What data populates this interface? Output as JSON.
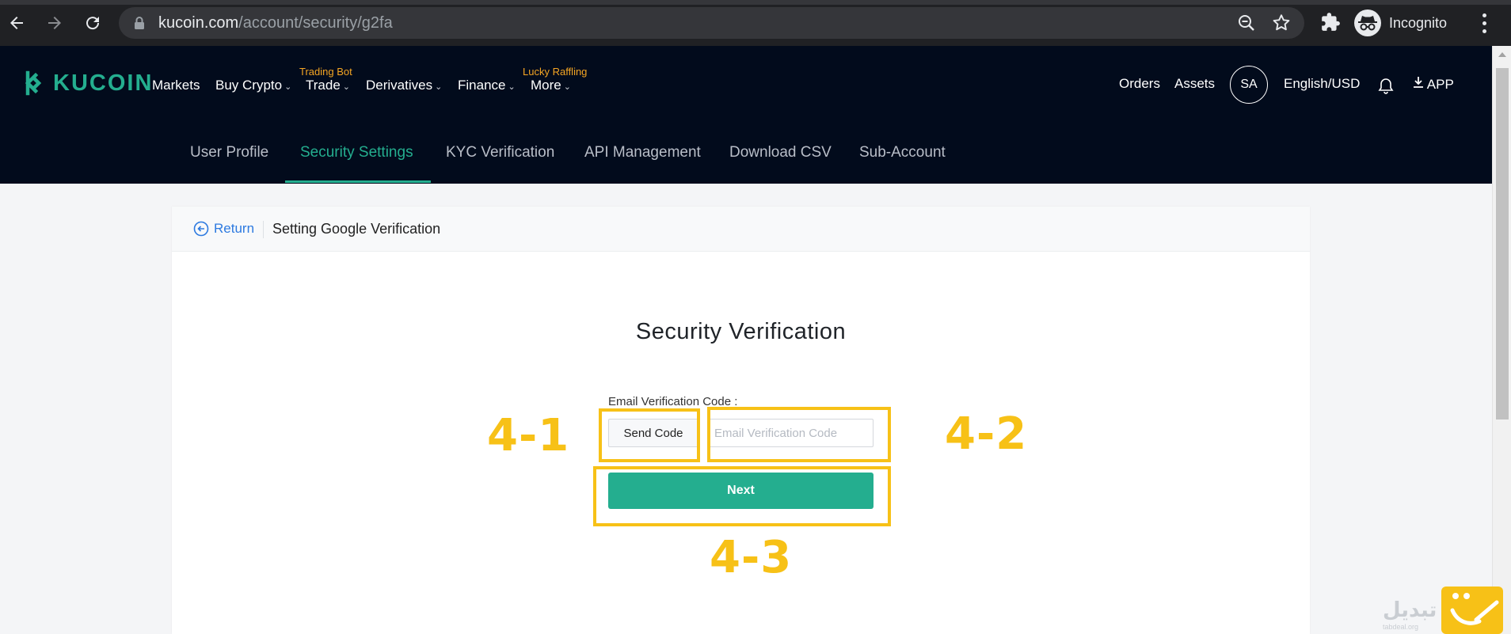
{
  "browser": {
    "url_host": "kucoin.com",
    "url_path": "/account/security/g2fa",
    "profile_label": "Incognito",
    "icons": [
      "back-icon",
      "forward-icon",
      "reload-icon",
      "lock-icon",
      "zoom-icon",
      "star-icon",
      "extensions-icon",
      "incognito-icon",
      "menu-icon"
    ]
  },
  "header": {
    "logo_text": "KUCOIN",
    "nav": [
      {
        "label": "Markets",
        "dropdown": false,
        "tag": ""
      },
      {
        "label": "Buy Crypto",
        "dropdown": true,
        "tag": ""
      },
      {
        "label": "Trade",
        "dropdown": true,
        "tag": "Trading Bot"
      },
      {
        "label": "Derivatives",
        "dropdown": true,
        "tag": ""
      },
      {
        "label": "Finance",
        "dropdown": true,
        "tag": ""
      },
      {
        "label": "More",
        "dropdown": true,
        "tag": "Lucky Raffling"
      }
    ],
    "right": {
      "orders": "Orders",
      "assets": "Assets",
      "avatar_initials": "SA",
      "language": "English/USD",
      "app": "APP"
    }
  },
  "subnav": {
    "tabs": [
      "User Profile",
      "Security Settings",
      "KYC Verification",
      "API Management",
      "Download CSV",
      "Sub-Account"
    ],
    "active": "Security Settings"
  },
  "card": {
    "return_label": "Return",
    "title": "Setting Google Verification",
    "section_title": "Security Verification",
    "field_label": "Email Verification Code :",
    "send_code_label": "Send Code",
    "code_placeholder": "Email Verification Code",
    "code_value": "",
    "next_label": "Next"
  },
  "annotations": [
    "4-1",
    "4-2",
    "4-3"
  ],
  "watermark": {
    "text": "تبدیل",
    "sub": "tabdeal.org"
  },
  "colors": {
    "brand": "#24ae8f",
    "header_bg": "#020b1c",
    "link": "#2d7ae0",
    "tag": "#f5a623",
    "annotation": "#f7c117"
  }
}
